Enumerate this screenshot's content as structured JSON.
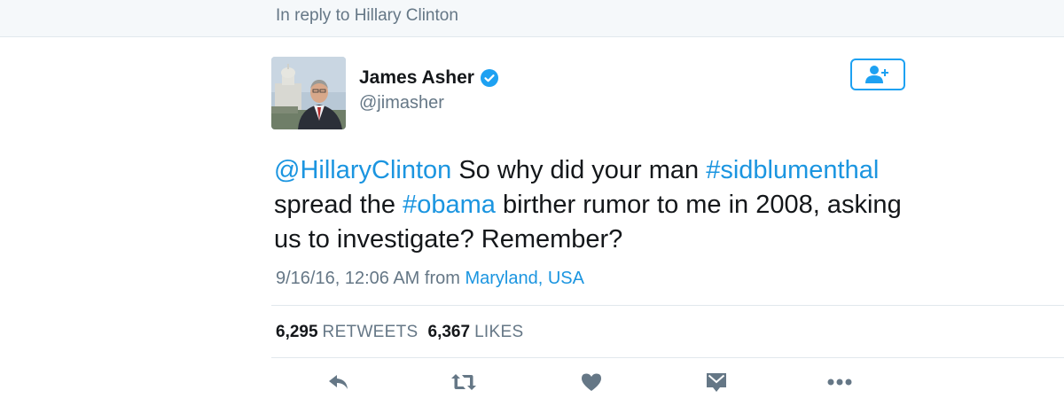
{
  "reply_bar": {
    "text": "In reply to Hillary Clinton"
  },
  "author": {
    "display_name": "James Asher",
    "handle": "@jimasher",
    "verified": true
  },
  "tweet": {
    "segments": [
      {
        "text": "@HillaryClinton",
        "type": "mention"
      },
      {
        "text": " So why did your man ",
        "type": "text"
      },
      {
        "text": "#sidblumenthal",
        "type": "hashtag"
      },
      {
        "text": " spread the ",
        "type": "text"
      },
      {
        "text": "#obama",
        "type": "hashtag"
      },
      {
        "text": " birther rumor to me in 2008, asking us to investigate? Remember?",
        "type": "text"
      }
    ]
  },
  "meta": {
    "timestamp": "9/16/16, 12:06 AM",
    "from_label": " from ",
    "location": "Maryland, USA"
  },
  "stats": {
    "retweets_count": "6,295",
    "retweets_label": "RETWEETS",
    "likes_count": "6,367",
    "likes_label": "LIKES"
  },
  "colors": {
    "link_blue": "#1b95e0",
    "action_gray": "#657786",
    "verified_blue": "#1da1f2"
  },
  "actions": [
    "reply-icon",
    "retweet-icon",
    "like-icon",
    "direct-message-icon",
    "more-icon"
  ]
}
